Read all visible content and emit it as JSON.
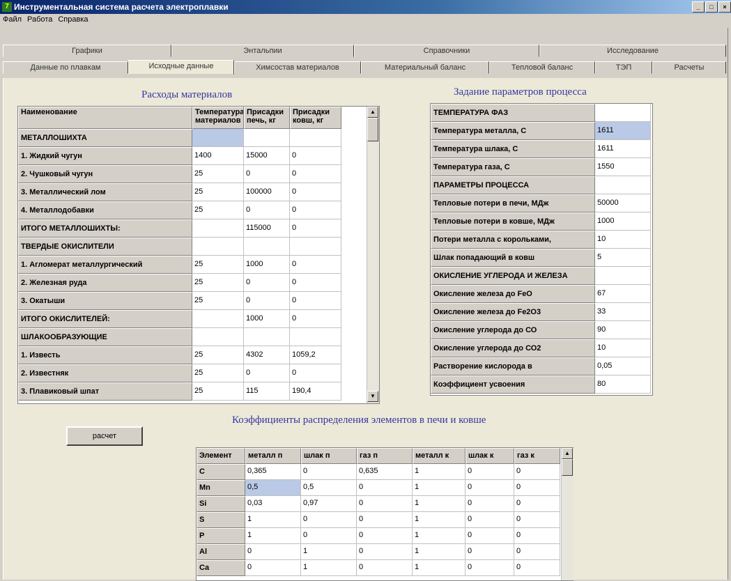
{
  "window": {
    "title": "Инструментальная система расчета электроплавки",
    "app_icon": "7",
    "btn_min": "_",
    "btn_max": "□",
    "btn_close": "×"
  },
  "menu": [
    "Файл",
    "Работа",
    "Справка"
  ],
  "tabs_top": [
    "Графики",
    "Энтальпии",
    "Справочники",
    "Исследование"
  ],
  "tabs_bottom": [
    "Данные по плавкам",
    "Исходные данные",
    "Химсостав материалов",
    "Материальный баланс",
    "Тепловой баланс",
    "ТЭП",
    "Расчеты"
  ],
  "materials": {
    "title": "Расходы материалов",
    "headers": [
      "Наименование",
      "Температура материалов",
      "Присадки печь, кг",
      "Присадки ковш, кг"
    ],
    "rows": [
      [
        "МЕТАЛЛОШИХТА",
        "",
        "",
        ""
      ],
      [
        "1. Жидкий чугун",
        "1400",
        "15000",
        "0"
      ],
      [
        "2. Чушковый чугун",
        "25",
        "0",
        "0"
      ],
      [
        "3. Металлический лом",
        "25",
        "100000",
        "0"
      ],
      [
        "4. Металлодобавки",
        "25",
        "0",
        "0"
      ],
      [
        "ИТОГО МЕТАЛЛОШИХТЫ:",
        "",
        "115000",
        "0"
      ],
      [
        "ТВЕРДЫЕ ОКИСЛИТЕЛИ",
        "",
        "",
        ""
      ],
      [
        "1. Агломерат металлургический",
        "25",
        "1000",
        "0"
      ],
      [
        "2. Железная руда",
        "25",
        "0",
        "0"
      ],
      [
        "3. Окатыши",
        "25",
        "0",
        "0"
      ],
      [
        "ИТОГО ОКИСЛИТЕЛЕЙ:",
        "",
        "1000",
        "0"
      ],
      [
        "ШЛАКООБРАЗУЮЩИЕ",
        "",
        "",
        ""
      ],
      [
        "1. Известь",
        "25",
        "4302",
        "1059,2"
      ],
      [
        "2. Известняк",
        "25",
        "0",
        "0"
      ],
      [
        "3. Плавиковый шпат",
        "25",
        "115",
        "190,4"
      ]
    ]
  },
  "process": {
    "title": "Задание параметров процесса",
    "rows": [
      [
        "ТЕМПЕРАТУРА ФАЗ",
        ""
      ],
      [
        "Температура металла, С",
        "1611"
      ],
      [
        "Температура шлака, С",
        "1611"
      ],
      [
        "Температура газа, С",
        "1550"
      ],
      [
        "ПАРАМЕТРЫ ПРОЦЕССА",
        ""
      ],
      [
        "Тепловые потери в печи, МДж",
        "50000"
      ],
      [
        "Тепловые потери в ковше, МДж",
        "1000"
      ],
      [
        "Потери металла с корольками,",
        "10"
      ],
      [
        "Шлак попадающий в ковш",
        "5"
      ],
      [
        "ОКИСЛЕНИЕ УГЛЕРОДА И ЖЕЛЕЗА",
        ""
      ],
      [
        "Окисление железа до FeO",
        "67"
      ],
      [
        "Окисление железа до Fe2O3",
        "33"
      ],
      [
        "Окисление углерода до СО",
        "90"
      ],
      [
        "Окисление углерода до СО2",
        "10"
      ],
      [
        "Растворение кислорода в",
        "0,05"
      ],
      [
        "Коэффициент усвоения",
        "80"
      ]
    ]
  },
  "button": {
    "label": "расчет"
  },
  "distribution": {
    "title": "Коэффициенты распределения элементов в печи и ковше",
    "headers": [
      "Элемент",
      "металл п",
      "шлак п",
      "газ п",
      "металл к",
      "шлак к",
      "газ к"
    ],
    "rows": [
      [
        "C",
        "0,365",
        "0",
        "0,635",
        "1",
        "0",
        "0"
      ],
      [
        "Mn",
        "0,5",
        "0,5",
        "0",
        "1",
        "0",
        "0"
      ],
      [
        "Si",
        "0,03",
        "0,97",
        "0",
        "1",
        "0",
        "0"
      ],
      [
        "S",
        "1",
        "0",
        "0",
        "1",
        "0",
        "0"
      ],
      [
        "P",
        "1",
        "0",
        "0",
        "1",
        "0",
        "0"
      ],
      [
        "Al",
        "0",
        "1",
        "0",
        "1",
        "0",
        "0"
      ],
      [
        "Ca",
        "0",
        "1",
        "0",
        "1",
        "0",
        "0"
      ]
    ]
  }
}
